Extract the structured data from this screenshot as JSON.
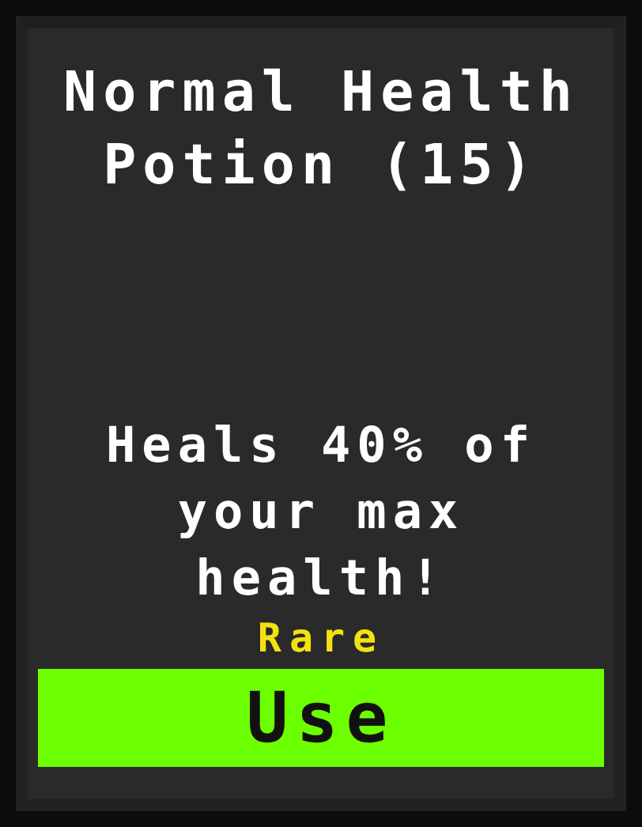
{
  "item": {
    "title": "Normal Health Potion (15)",
    "description": "Heals 40% of your max health!",
    "rarity": "Rare",
    "button": "Use"
  }
}
